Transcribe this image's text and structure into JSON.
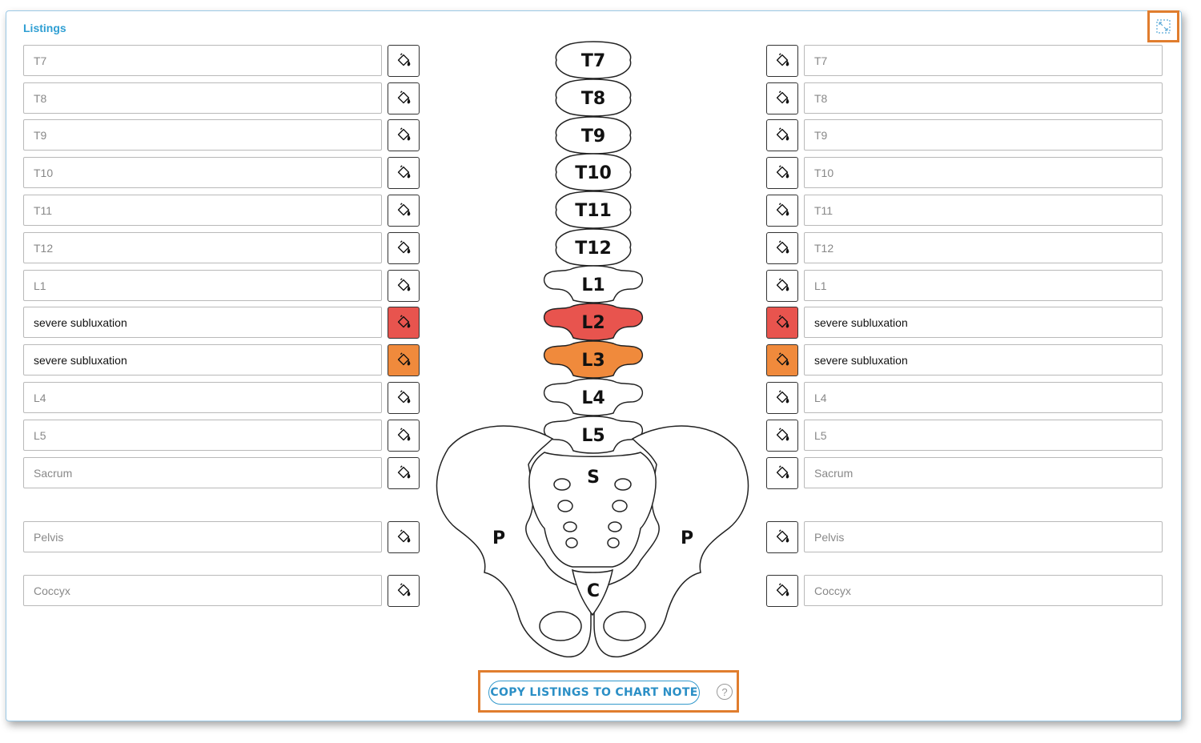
{
  "section_title": "Listings",
  "icons": {
    "expand": "expand-icon",
    "paint": "paint-bucket-icon",
    "help": "help-icon"
  },
  "colors": {
    "accent": "#2f9fd3",
    "l2_red": "#e8544e",
    "l3_orange": "#f08a3c",
    "highlight_box": "#e07d2e"
  },
  "rows": [
    {
      "id": "t7",
      "left": "T7",
      "right": "T7"
    },
    {
      "id": "t8",
      "left": "T8",
      "right": "T8"
    },
    {
      "id": "t9",
      "left": "T9",
      "right": "T9"
    },
    {
      "id": "t10",
      "left": "T10",
      "right": "T10"
    },
    {
      "id": "t11",
      "left": "T11",
      "right": "T11"
    },
    {
      "id": "t12",
      "left": "T12",
      "right": "T12"
    },
    {
      "id": "l1",
      "left": "L1",
      "right": "L1"
    },
    {
      "id": "l2",
      "left": "severe subluxation",
      "right": "severe subluxation",
      "color": "#e8544e"
    },
    {
      "id": "l3",
      "left": "severe subluxation",
      "right": "severe subluxation",
      "color": "#f08a3c"
    },
    {
      "id": "l4",
      "left": "L4",
      "right": "L4"
    },
    {
      "id": "l5",
      "left": "L5",
      "right": "L5"
    },
    {
      "id": "sacrum",
      "left": "Sacrum",
      "right": "Sacrum"
    },
    {
      "id": "pelvis",
      "left": "Pelvis",
      "right": "Pelvis"
    },
    {
      "id": "coccyx",
      "left": "Coccyx",
      "right": "Coccyx"
    }
  ],
  "spine_labels": {
    "t7": "T7",
    "t8": "T8",
    "t9": "T9",
    "t10": "T10",
    "t11": "T11",
    "t12": "T12",
    "l1": "L1",
    "l2": "L2",
    "l3": "L3",
    "l4": "L4",
    "l5": "L5",
    "sacrum": "S",
    "pelvis_left": "P",
    "pelvis_right": "P",
    "coccyx": "C"
  },
  "copy_button": "COPY LISTINGS TO CHART NOTE",
  "help_glyph": "?"
}
